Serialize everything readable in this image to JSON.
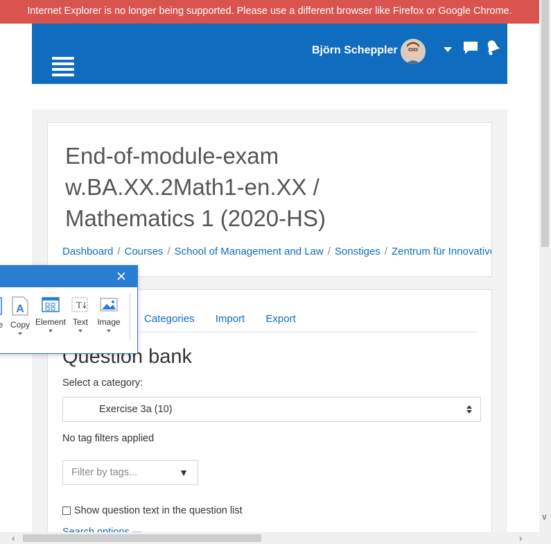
{
  "banner": {
    "text": "Internet Explorer is no longer being supported. Please use a different browser like Firefox or Google Chrome."
  },
  "navbar": {
    "user_name": "Björn Scheppler"
  },
  "header": {
    "title": "End-of-module-exam w.BA.XX.2Math1-en.XX / Mathematics 1 (2020-HS)",
    "breadcrumb": [
      "Dashboard",
      "Courses",
      "School of Management and Law",
      "Sonstiges",
      "Zentrum für Innovative D"
    ]
  },
  "tabs": [
    "Categories",
    "Import",
    "Export"
  ],
  "question_bank": {
    "title": "Question bank",
    "category_label": "Select a category:",
    "category_value": "Exercise 3a (10)",
    "tag_note": "No tag filters applied",
    "tag_placeholder": "Filter by tags...",
    "show_text_label": "Show question text in the question list",
    "search_options": "Search options ▬"
  },
  "toolbar": {
    "tools": [
      {
        "label": "e",
        "icon": "partial-icon"
      },
      {
        "label": "Copy",
        "icon": "copy-text-icon"
      },
      {
        "label": "Element",
        "icon": "element-grid-icon"
      },
      {
        "label": "Text",
        "icon": "text-icon"
      },
      {
        "label": "Image",
        "icon": "image-icon"
      }
    ]
  },
  "colors": {
    "brand": "#0f6cbf",
    "banner": "#d9534f",
    "toolbar_accent": "#2b7cd3"
  }
}
